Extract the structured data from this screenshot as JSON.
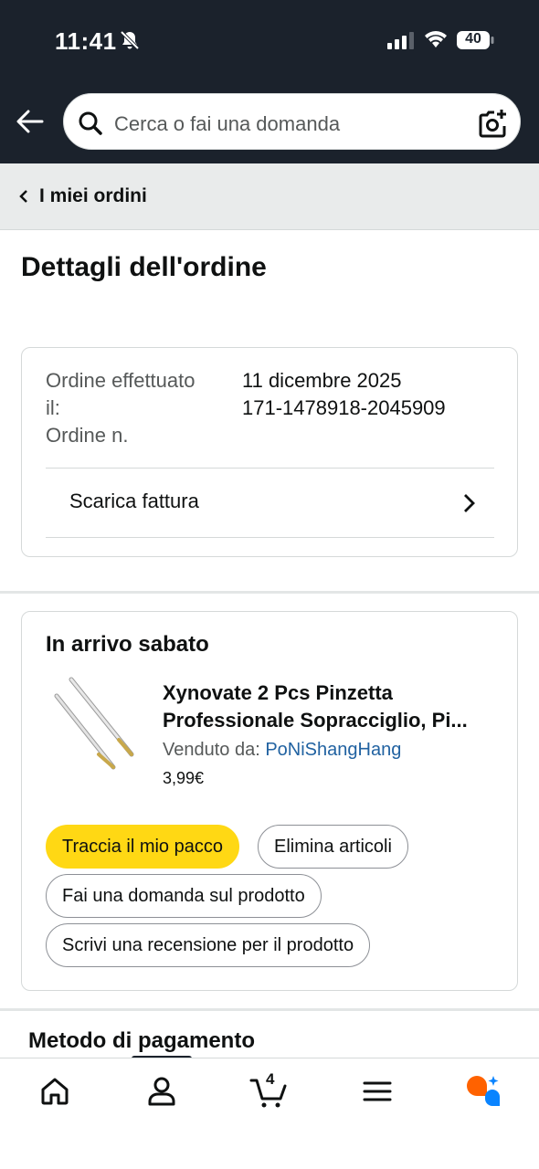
{
  "status_bar": {
    "time": "11:41",
    "battery": "40"
  },
  "search": {
    "placeholder": "Cerca o fai una domanda"
  },
  "breadcrumb": {
    "label": "I miei ordini"
  },
  "page": {
    "title": "Dettagli dell'ordine"
  },
  "order": {
    "placed_label": "Ordine effettuato il:",
    "placed_value": "11 dicembre 2025",
    "number_label": "Ordine n.",
    "number_value": "171-1478918-2045909",
    "invoice_label": "Scarica fattura"
  },
  "shipment": {
    "title": "In arrivo sabato",
    "product_title": "Xynovate 2 Pcs Pinzetta Professionale Sopracciglio, Pi...",
    "seller_prefix": "Venduto da: ",
    "seller_name": "PoNiShangHang",
    "price": "3,99€",
    "buttons": {
      "track": "Traccia il mio pacco",
      "delete": "Elimina articoli",
      "ask": "Fai una domanda sul prodotto",
      "review": "Scrivi una recensione per il prodotto"
    }
  },
  "payment": {
    "title": "Metodo di pagamento"
  },
  "bottom_nav": {
    "cart_count": "4"
  },
  "colors": {
    "header": "#1b222c",
    "accent_yellow": "#ffd814",
    "link": "#2162a1",
    "rufus_orange": "#ff6200",
    "rufus_blue": "#0a84ff"
  }
}
